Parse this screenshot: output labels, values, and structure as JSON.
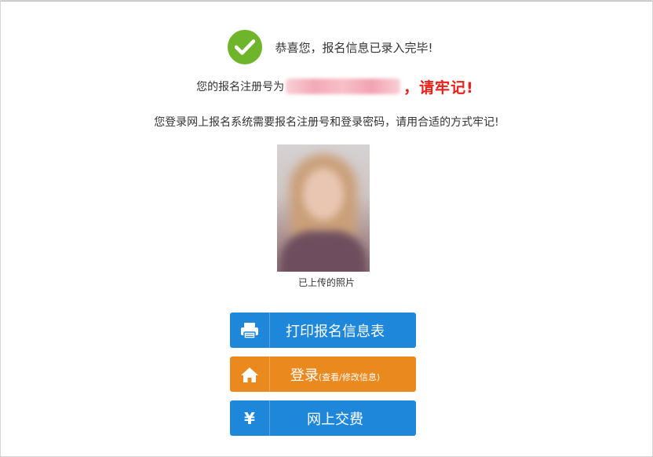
{
  "success": {
    "message": "恭喜您，报名信息已录入完毕!"
  },
  "registration": {
    "label": "您的报名注册号为",
    "number": "",
    "remember": "，请牢记!"
  },
  "hint": "您登录网上报名系统需要报名注册号和登录密码，请用合适的方式牢记!",
  "photo": {
    "caption": "已上传的照片"
  },
  "buttons": {
    "print": {
      "label": "打印报名信息表",
      "icon": "printer-icon"
    },
    "login": {
      "label": "登录",
      "sub": "(查看/修改信息)",
      "icon": "home-icon"
    },
    "pay": {
      "label": "网上交费",
      "icon_glyph": "¥",
      "icon": "yen-icon"
    }
  },
  "colors": {
    "success_green": "#6fb52c",
    "remember_red": "#e8201a",
    "button_blue": "#1e87da",
    "button_orange": "#ea8a1e"
  }
}
